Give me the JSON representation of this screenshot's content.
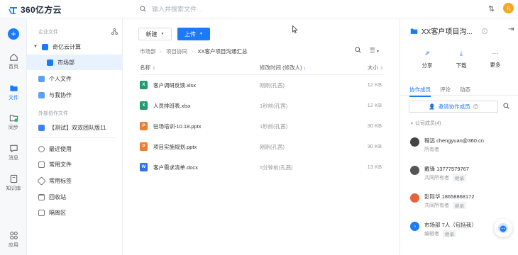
{
  "app": {
    "logo_text": "360亿方云",
    "search_placeholder": "输入并搜索文件...",
    "user_initial": "孔"
  },
  "rail": {
    "items": [
      {
        "label": "首页"
      },
      {
        "label": "文件"
      },
      {
        "label": "同步"
      },
      {
        "label": "消息"
      },
      {
        "label": "知识库"
      },
      {
        "label": "应用"
      }
    ]
  },
  "sidenav": {
    "section_enterprise": "企业文件",
    "company": "奇亿云计算",
    "market": "市场部",
    "personal": "个人文件",
    "shared": "与我协作",
    "section_external": "外部协作文件",
    "external_team": "【测试】双双团队版11",
    "recent": "最近使用",
    "common": "常用文件",
    "tags": "常用标签",
    "recycle": "回收站",
    "quarantine": "隔离区"
  },
  "main": {
    "new_label": "新建",
    "upload_label": "上传",
    "breadcrumb": [
      "市场部",
      "项目协同",
      "XX客户项目沟通汇总"
    ],
    "col_name": "名称",
    "col_modified": "修改时间 (修改人)",
    "col_size": "大小",
    "files": [
      {
        "name": "客户调研反馈.xlsx",
        "modified": "刚刚(孔茜)",
        "size": "12 KB",
        "type": "xlsx"
      },
      {
        "name": "人员排班表.xlsx",
        "modified": "1秒前(孔茜)",
        "size": "12 KB",
        "type": "xlsx"
      },
      {
        "name": "驻场培训-10.18.pptx",
        "modified": "1秒前(孔茜)",
        "size": "30 KB",
        "type": "pptx"
      },
      {
        "name": "项目实施规划.pptx",
        "modified": "刚刚(孔茜)",
        "size": "30 KB",
        "type": "pptx"
      },
      {
        "name": "客户需求清单.docx",
        "modified": "5分钟前(孔茜)",
        "size": "13 KB",
        "type": "docx"
      }
    ]
  },
  "panel": {
    "title": "XX客户项目沟...",
    "share": "分享",
    "download": "下载",
    "more": "更多",
    "tabs": [
      "协作成员",
      "评论",
      "动态"
    ],
    "invite": "邀请协作成员",
    "company_group": "公司成员(4)",
    "members": [
      {
        "name": "程远 chengyuan@360.cn",
        "role": "所有者",
        "tag": ""
      },
      {
        "name": "戴锋 13777579767",
        "role": "共同所有者",
        "tag": "继承"
      },
      {
        "name": "彭际华 18658868172",
        "role": "共同所有者",
        "tag": "继承"
      },
      {
        "name": "市场部 7人（包括我）",
        "role": "编辑者",
        "tag": "继承"
      }
    ]
  },
  "colors": {
    "accent": "#1a7af8",
    "xlsx": "#1f9d6b",
    "pptx": "#f07c2f",
    "docx": "#2f6ff0"
  }
}
